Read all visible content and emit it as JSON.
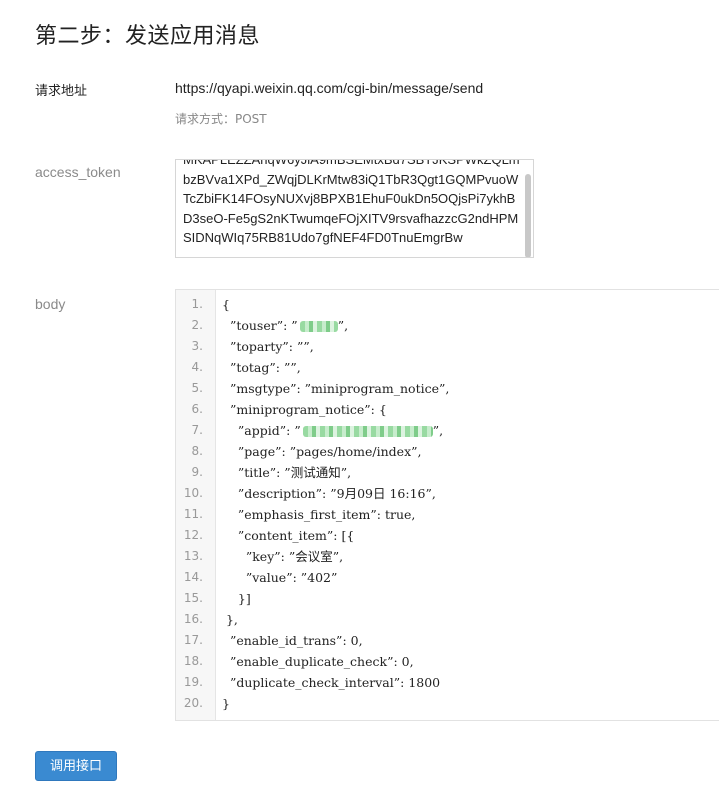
{
  "page": {
    "title": "第二步：发送应用消息"
  },
  "request": {
    "url_label": "请求地址",
    "url": "https://qyapi.weixin.qq.com/cgi-bin/message/send",
    "method_text": "请求方式：POST"
  },
  "access_token": {
    "label": "access_token",
    "value": "MKAPLEZZAhqW6yJlA9mBSEMtxBd7SBTJKSPWkZQLmbzBVva1XPd_ZWqjDLKrMtw83iQ1TbR3Qgt1GQMPvuoWTcZbiFK14FOsyNUXvj8BPXB1EhuF0ukDn5OQjsPi7ykhBD3seO-Fe5gS2nKTwumqeFOjXITV9rsvafhazzcG2ndHPMSIDNqWIq75RB81Udo7gfNEF4FD0TnuEmgrBw"
  },
  "body": {
    "label": "body",
    "lines": [
      {
        "n": "1.",
        "t": "{"
      },
      {
        "n": "2.",
        "t": "  ”touser”: ”"
      },
      {
        "n": "3.",
        "t": "  ”toparty”: ””,"
      },
      {
        "n": "4.",
        "t": "  ”totag”: ””,"
      },
      {
        "n": "5.",
        "t": "  ”msgtype”: ”miniprogram_notice”,"
      },
      {
        "n": "6.",
        "t": "  ”miniprogram_notice”: {"
      },
      {
        "n": "7.",
        "t": "    ”appid”: ”"
      },
      {
        "n": "8.",
        "t": "    ”page”: ”pages/home/index”,"
      },
      {
        "n": "9.",
        "t": "    ”title”: ”测试通知”,"
      },
      {
        "n": "10.",
        "t": "    ”description”: ”9月09日 16:16”,"
      },
      {
        "n": "11.",
        "t": "    ”emphasis_first_item”: true,"
      },
      {
        "n": "12.",
        "t": "    ”content_item”: [{"
      },
      {
        "n": "13.",
        "t": "      ”key”: ”会议室”,"
      },
      {
        "n": "14.",
        "t": "      ”value”: ”402”"
      },
      {
        "n": "15.",
        "t": "    }]"
      },
      {
        "n": "16.",
        "t": " },"
      },
      {
        "n": "17.",
        "t": "  ”enable_id_trans”: 0,"
      },
      {
        "n": "18.",
        "t": "  ”enable_duplicate_check”: 0,"
      },
      {
        "n": "19.",
        "t": "  ”duplicate_check_interval”: 1800"
      },
      {
        "n": "20.",
        "t": "}"
      }
    ]
  },
  "actions": {
    "call_button": "调用接口"
  }
}
